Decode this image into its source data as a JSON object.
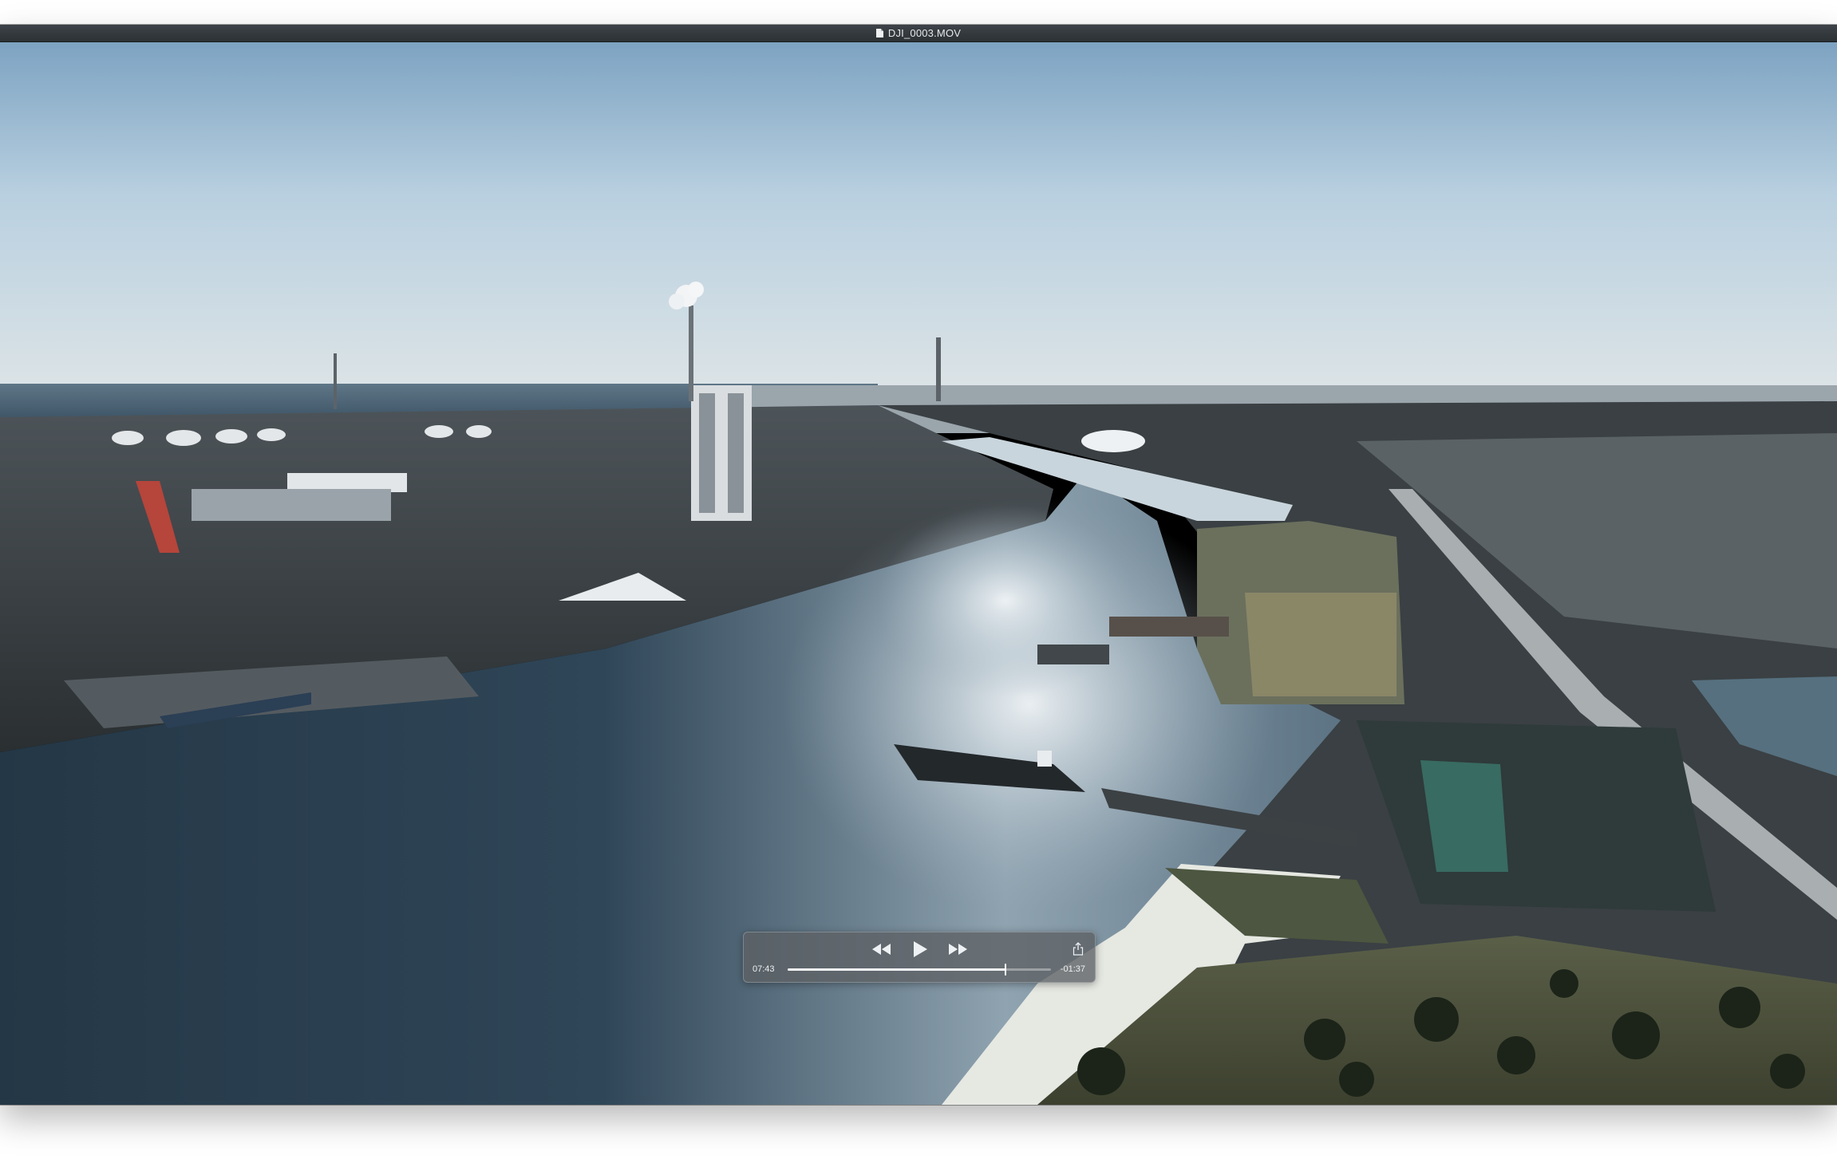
{
  "window": {
    "title": "DJI_0003.MOV",
    "title_icon": "document-icon"
  },
  "controls": {
    "rewind_icon": "rewind-icon",
    "play_icon": "play-icon",
    "fast_forward_icon": "fast-forward-icon",
    "share_icon": "share-icon",
    "elapsed": "07:43",
    "remaining": "-01:37",
    "progress": 0.8266
  }
}
